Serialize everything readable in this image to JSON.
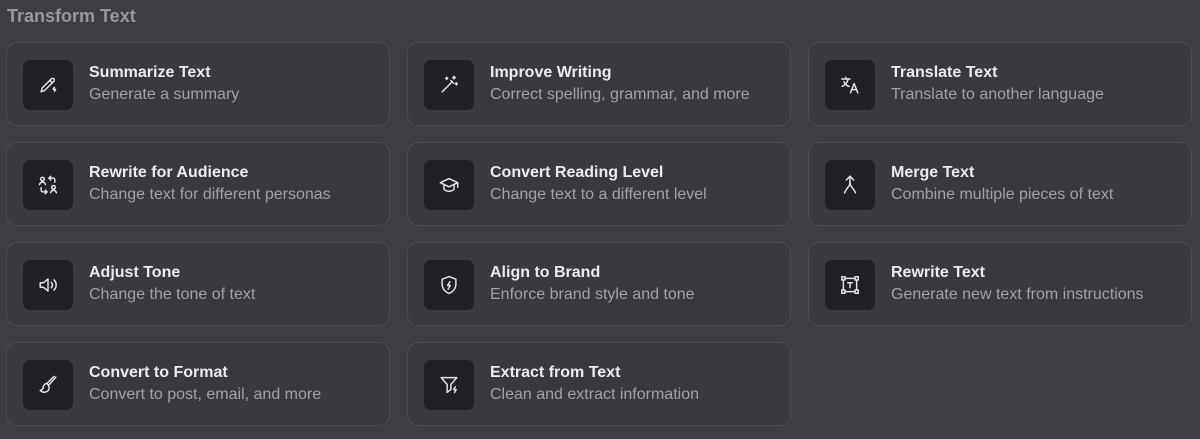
{
  "section_title": "Transform Text",
  "cards": [
    {
      "title": "Summarize Text",
      "description": "Generate a summary",
      "icon": "pencil-sparkle-icon"
    },
    {
      "title": "Improve Writing",
      "description": "Correct spelling, grammar, and more",
      "icon": "magic-wand-icon"
    },
    {
      "title": "Translate Text",
      "description": "Translate to another language",
      "icon": "translate-icon"
    },
    {
      "title": "Rewrite for Audience",
      "description": "Change text for different personas",
      "icon": "swap-users-icon"
    },
    {
      "title": "Convert Reading Level",
      "description": "Change text to a different level",
      "icon": "graduation-cap-icon"
    },
    {
      "title": "Merge Text",
      "description": "Combine multiple pieces of text",
      "icon": "merge-arrow-icon"
    },
    {
      "title": "Adjust Tone",
      "description": "Change the tone of text",
      "icon": "volume-icon"
    },
    {
      "title": "Align to Brand",
      "description": "Enforce brand style and tone",
      "icon": "shield-bolt-icon"
    },
    {
      "title": "Rewrite Text",
      "description": "Generate new text from instructions",
      "icon": "text-frame-icon"
    },
    {
      "title": "Convert to Format",
      "description": "Convert to post, email, and more",
      "icon": "paint-brush-icon"
    },
    {
      "title": "Extract from Text",
      "description": "Clean and extract information",
      "icon": "filter-bolt-icon"
    }
  ]
}
